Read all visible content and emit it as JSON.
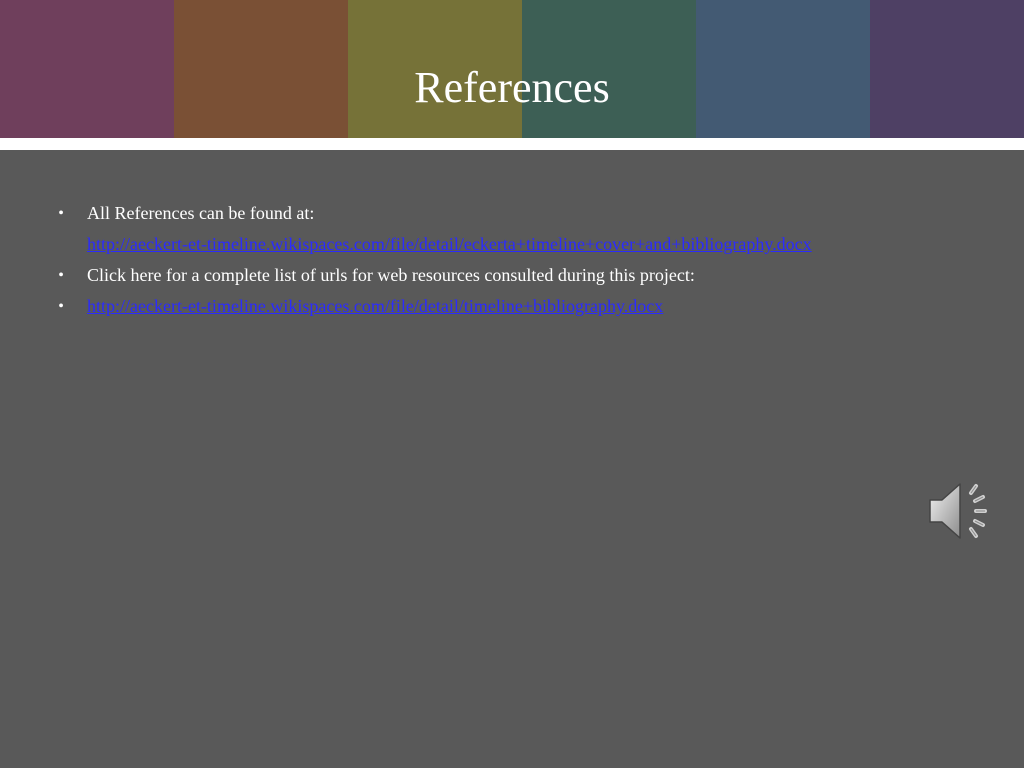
{
  "slide": {
    "title": "References",
    "header_stripe_colors": [
      "#6f3f5c",
      "#7a5035",
      "#767238",
      "#3d5f55",
      "#435a73",
      "#4e4064"
    ],
    "band_color": "#ffffff",
    "background_color": "#595959",
    "link_color": "#2b2bff"
  },
  "bullets": [
    {
      "text": "All References can be found at:",
      "link": "http://aeckert-et-timeline.wikispaces.com/file/detail/eckerta+timeline+cover+and+bibliography.docx"
    },
    {
      "text": "Click here for a complete list of  urls for web resources consulted during this project:"
    },
    {
      "link": "http://aeckert-et-timeline.wikispaces.com/file/detail/timeline+bibliography.docx"
    }
  ],
  "bullet_glyph": "•",
  "icons": {
    "audio": "speaker-icon"
  }
}
